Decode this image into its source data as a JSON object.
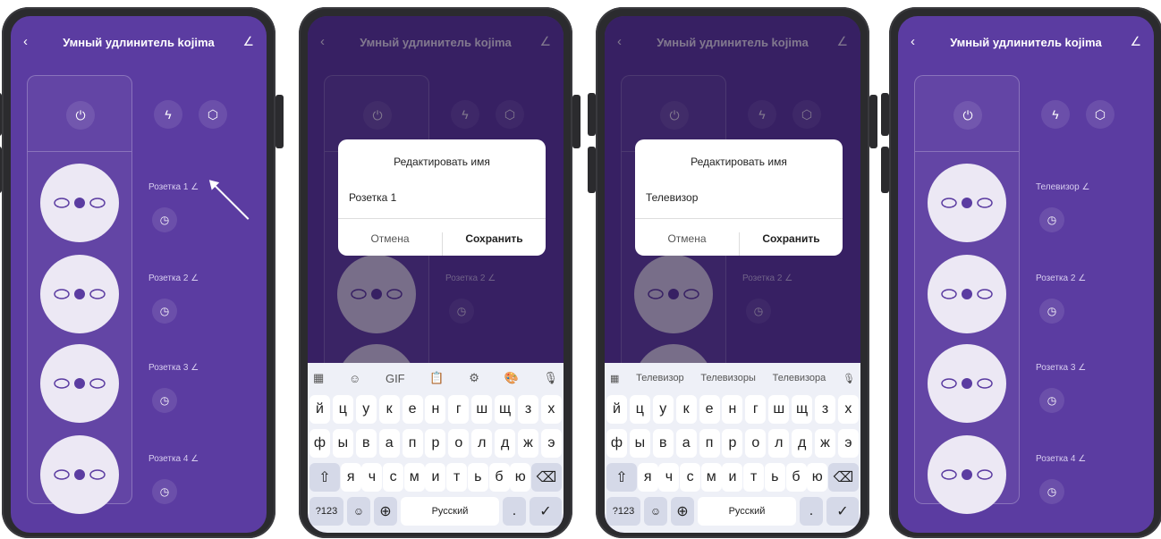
{
  "screen_title": "Умный удлинитель kojima",
  "outlets": [
    "Розетка 1",
    "Розетка 2",
    "Розетка 3",
    "Розетка 4"
  ],
  "outlets_after": [
    "Телевизор",
    "Розетка 2",
    "Розетка 3",
    "Розетка 4"
  ],
  "dialog": {
    "title": "Редактировать имя",
    "value_before": "Розетка 1",
    "value_after": "Телевизор",
    "cancel": "Отмена",
    "save": "Сохранить"
  },
  "keyboard": {
    "row1": [
      "й",
      "ц",
      "у",
      "к",
      "е",
      "н",
      "г",
      "ш",
      "щ",
      "з",
      "х"
    ],
    "row2": [
      "ф",
      "ы",
      "в",
      "а",
      "п",
      "р",
      "о",
      "л",
      "д",
      "ж",
      "э"
    ],
    "row3": [
      "я",
      "ч",
      "с",
      "м",
      "и",
      "т",
      "ь",
      "б",
      "ю"
    ],
    "mode": "?123",
    "space": "Русский",
    "suggestions": [
      "Телевизор",
      "Телевизоры",
      "Телевизора"
    ]
  },
  "icons": [
    "back-icon",
    "edit-icon",
    "power-icon",
    "lightning-icon",
    "cube-icon",
    "clock-icon",
    "mic-icon",
    "backspace-icon",
    "shift-icon",
    "globe-icon",
    "check-icon"
  ],
  "colors": {
    "purple": "#5b3ca1",
    "socket": "#ece8f4"
  }
}
